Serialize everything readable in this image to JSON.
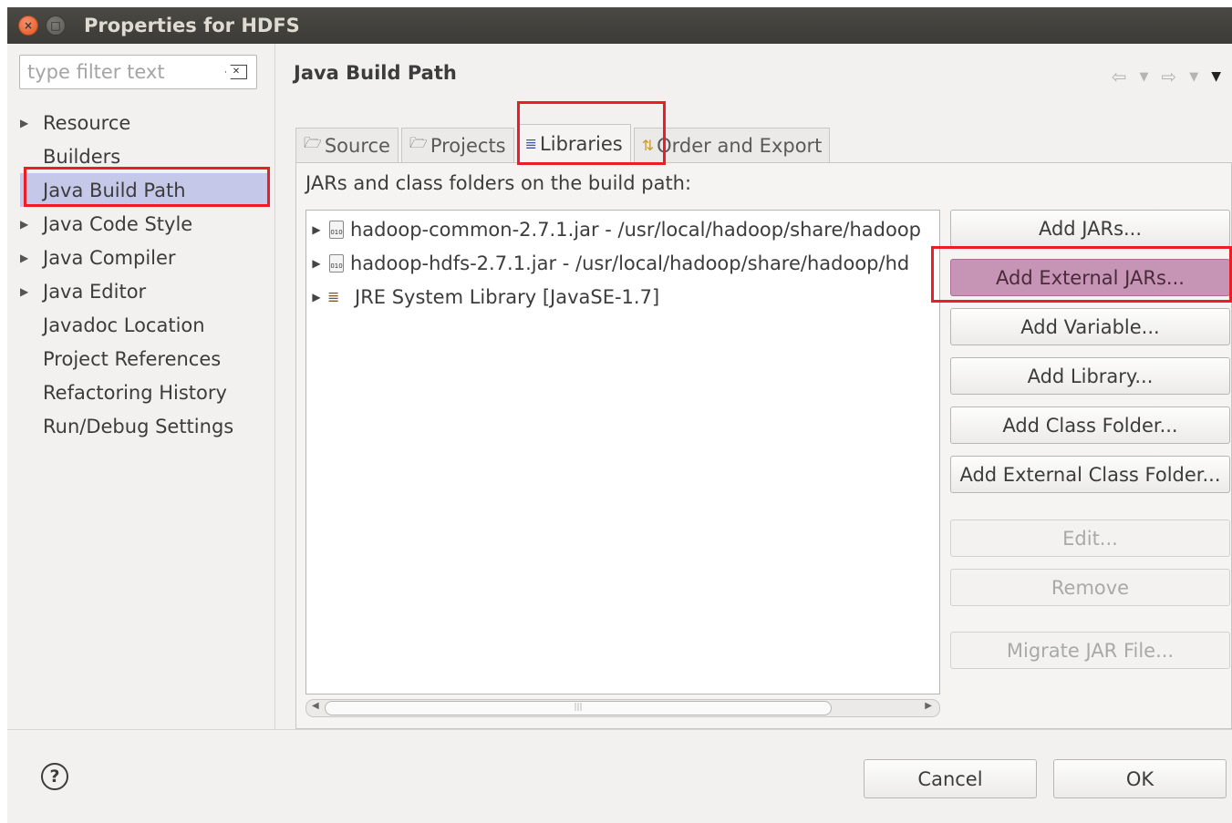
{
  "window": {
    "title": "Properties for HDFS",
    "close_glyph": "×",
    "min_glyph": "□"
  },
  "filter": {
    "placeholder": "type filter text",
    "value": ""
  },
  "tree": [
    {
      "label": "Resource",
      "expandable": true,
      "selected": false
    },
    {
      "label": "Builders",
      "expandable": false,
      "selected": false
    },
    {
      "label": "Java Build Path",
      "expandable": false,
      "selected": true
    },
    {
      "label": "Java Code Style",
      "expandable": true,
      "selected": false
    },
    {
      "label": "Java Compiler",
      "expandable": true,
      "selected": false
    },
    {
      "label": "Java Editor",
      "expandable": true,
      "selected": false
    },
    {
      "label": "Javadoc Location",
      "expandable": false,
      "selected": false
    },
    {
      "label": "Project References",
      "expandable": false,
      "selected": false
    },
    {
      "label": "Refactoring History",
      "expandable": false,
      "selected": false
    },
    {
      "label": "Run/Debug Settings",
      "expandable": false,
      "selected": false
    }
  ],
  "page": {
    "title": "Java Build Path",
    "tabs": [
      {
        "label": "Source",
        "icon": "source-folder-icon",
        "active": false
      },
      {
        "label": "Projects",
        "icon": "projects-folder-icon",
        "active": false
      },
      {
        "label": "Libraries",
        "icon": "libraries-icon",
        "active": true
      },
      {
        "label": "Order and Export",
        "icon": "order-export-icon",
        "active": false
      }
    ],
    "description": "JARs and class folders on the build path:",
    "libraries": [
      {
        "label": "hadoop-common-2.7.1.jar - /usr/local/hadoop/share/hadoop",
        "icon": "jar-icon"
      },
      {
        "label": "hadoop-hdfs-2.7.1.jar - /usr/local/hadoop/share/hadoop/hd",
        "icon": "jar-icon"
      },
      {
        "label": "JRE System Library [JavaSE-1.7]",
        "icon": "library-icon"
      }
    ],
    "buttons": [
      {
        "label": "Add JARs...",
        "enabled": true,
        "highlighted": false
      },
      {
        "label": "Add External JARs...",
        "enabled": true,
        "highlighted": true
      },
      {
        "label": "Add Variable...",
        "enabled": true,
        "highlighted": false
      },
      {
        "label": "Add Library...",
        "enabled": true,
        "highlighted": false
      },
      {
        "label": "Add Class Folder...",
        "enabled": true,
        "highlighted": false
      },
      {
        "label": "Add External Class Folder...",
        "enabled": true,
        "highlighted": false
      },
      {
        "label": "Edit...",
        "enabled": false,
        "highlighted": false
      },
      {
        "label": "Remove",
        "enabled": false,
        "highlighted": false
      },
      {
        "label": "Migrate JAR File...",
        "enabled": false,
        "highlighted": false
      }
    ]
  },
  "footer": {
    "cancel_label": "Cancel",
    "ok_label": "OK"
  },
  "colors": {
    "annotation": "#ee1c25",
    "selection": "#c5c8e8",
    "highlight_button": "#c694b5"
  }
}
